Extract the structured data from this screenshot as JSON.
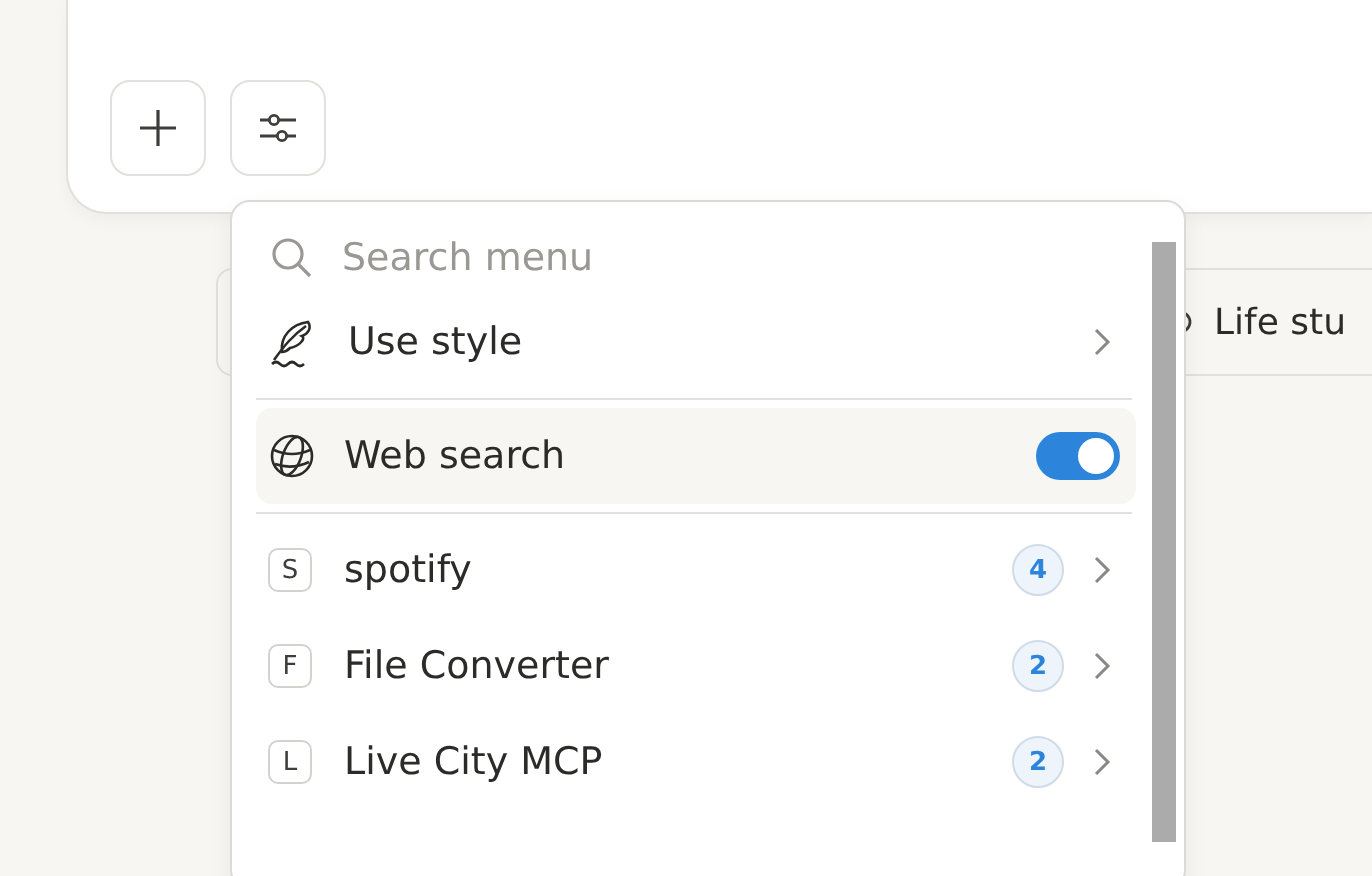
{
  "composer": {
    "buttons": [
      {
        "kind": "add"
      },
      {
        "kind": "tools"
      }
    ]
  },
  "suggestions": [
    {
      "kind": "blank"
    },
    {
      "kind": "chip",
      "label": "Life stu"
    }
  ],
  "menu": {
    "search": {
      "placeholder": "Search menu"
    },
    "sections": [
      [
        {
          "kind": "submenu",
          "label": "Use style"
        }
      ],
      [
        {
          "kind": "toggle",
          "label": "Web search",
          "on": true,
          "hovered": true
        }
      ],
      [
        {
          "kind": "connector",
          "letter": "S",
          "label": "spotify",
          "count": "4"
        },
        {
          "kind": "connector",
          "letter": "F",
          "label": "File Converter",
          "count": "2"
        },
        {
          "kind": "connector",
          "letter": "L",
          "label": "Live City MCP",
          "count": "2"
        }
      ]
    ]
  }
}
